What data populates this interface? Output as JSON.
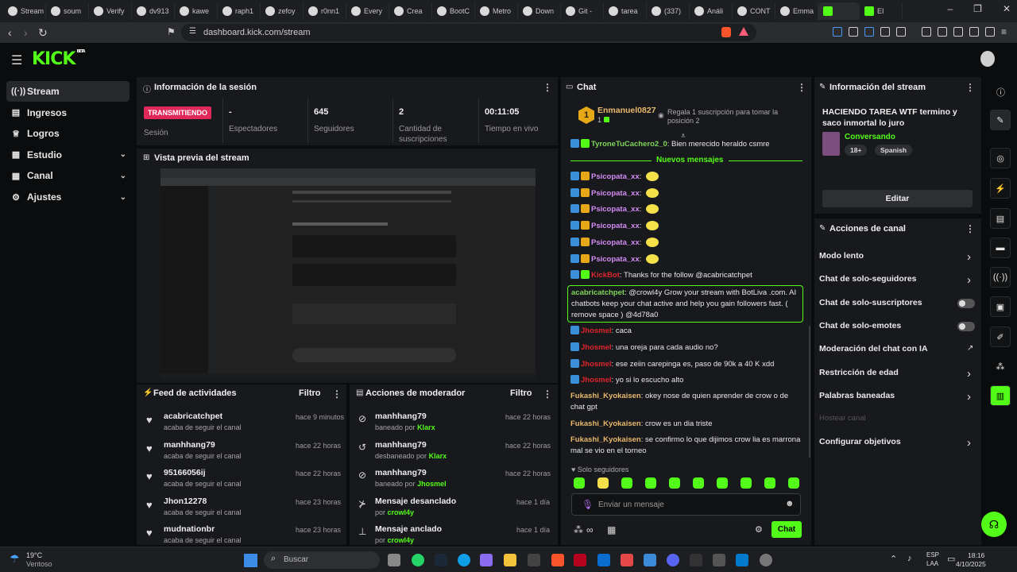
{
  "browser": {
    "tabs": [
      "Stream",
      "soum",
      "Verify",
      "dv913",
      "kawe",
      "raph1",
      "zefoy",
      "r0nn1",
      "Every",
      "Crea",
      "BootC",
      "Metro",
      "Down",
      "Git -",
      "tarea",
      "(337)",
      "Análi",
      "CONT",
      "Emma",
      "",
      "EI"
    ],
    "url": "dashboard.kick.com/stream"
  },
  "brand": {
    "logo": "KICK",
    "beta": "BETA",
    "accent": "#53fc18"
  },
  "sidebar": {
    "items": [
      {
        "label": "Stream",
        "icon": "broadcast-icon",
        "active": true
      },
      {
        "label": "Ingresos",
        "icon": "wallet-icon"
      },
      {
        "label": "Logros",
        "icon": "trophy-icon"
      },
      {
        "label": "Estudio",
        "icon": "layout-icon",
        "expandable": true
      },
      {
        "label": "Canal",
        "icon": "user-icon",
        "expandable": true
      },
      {
        "label": "Ajustes",
        "icon": "gear-icon",
        "expandable": true
      }
    ]
  },
  "session": {
    "title": "Información de la sesión",
    "live_badge": "TRANSMITIENDO",
    "session_label": "Sesión",
    "stats": [
      {
        "value": "-",
        "label": "Espectadores"
      },
      {
        "value": "645",
        "label": "Seguidores"
      },
      {
        "value": "2",
        "label": "Cantidad de suscripciones"
      },
      {
        "value": "00:11:05",
        "label": "Tiempo en vivo"
      }
    ]
  },
  "preview": {
    "title": "Vista previa del stream"
  },
  "activity": {
    "title": "Feed de actividades",
    "filter": "Filtro",
    "items": [
      {
        "name": "acabricatchpet",
        "sub": "acaba de seguir el canal",
        "time": "hace 9 minutos"
      },
      {
        "name": "manhhang79",
        "sub": "acaba de seguir el canal",
        "time": "hace 22 horas"
      },
      {
        "name": "95166056ij",
        "sub": "acaba de seguir el canal",
        "time": "hace 22 horas"
      },
      {
        "name": "Jhon12278",
        "sub": "acaba de seguir el canal",
        "time": "hace 23 horas"
      },
      {
        "name": "mudnationbr",
        "sub": "acaba de seguir el canal",
        "time": "hace 23 horas"
      }
    ]
  },
  "mod": {
    "title": "Acciones de moderador",
    "filter": "Filtro",
    "items": [
      {
        "name": "manhhang79",
        "sub": "baneado por",
        "by": "Klarx",
        "time": "hace 22 horas",
        "icon": "ban-icon"
      },
      {
        "name": "manhhang79",
        "sub": "desbaneado por",
        "by": "Klarx",
        "time": "hace 22 horas",
        "icon": "undo-icon"
      },
      {
        "name": "manhhang79",
        "sub": "baneado por",
        "by": "Jhosmel",
        "time": "hace 22 horas",
        "icon": "ban-icon"
      },
      {
        "name": "Mensaje desanclado",
        "sub": "por",
        "by": "crowl4y",
        "time": "hace 1 día",
        "icon": "unpin-icon"
      },
      {
        "name": "Mensaje anclado",
        "sub": "por",
        "by": "crowl4y",
        "time": "hace 1 día",
        "icon": "pin-icon"
      }
    ]
  },
  "chat": {
    "title": "Chat",
    "top_user": "Enmanuel0827",
    "top_count": "1",
    "rank": "1",
    "gift_msg": "Regala 1 suscripción para tomar la posición 2",
    "prev_msg": {
      "user": "TyroneTuCachero2_0",
      "text": "Bien merecido heraldo csmre"
    },
    "new_messages": "Nuevos mensajes",
    "messages": [
      {
        "user": "Psicopata_xx",
        "text": "",
        "color": "#d38cf5",
        "emoji": true
      },
      {
        "user": "Psicopata_xx",
        "text": "",
        "color": "#d38cf5",
        "emoji": true
      },
      {
        "user": "Psicopata_xx",
        "text": "",
        "color": "#d38cf5",
        "emoji": true
      },
      {
        "user": "Psicopata_xx",
        "text": "",
        "color": "#d38cf5",
        "emoji": true
      },
      {
        "user": "Psicopata_xx",
        "text": "",
        "color": "#d38cf5",
        "emoji": true
      },
      {
        "user": "Psicopata_xx",
        "text": "",
        "color": "#d38cf5",
        "emoji": true
      },
      {
        "user": "KickBot",
        "text": "Thanks for the follow @acabricatchpet",
        "color": "#e0252d"
      }
    ],
    "highlight": {
      "user": "acabricatchpet",
      "text": "@crowl4y Grow your stream with BotLiva .com. AI chatbots keep your chat active and help you gain followers fast. ( remove space ) @4d78a0"
    },
    "messages2": [
      {
        "user": "Jhosmel",
        "text": "caca",
        "color": "#e0252d"
      },
      {
        "user": "Jhosmel",
        "text": "una oreja para cada audio no?",
        "color": "#e0252d"
      },
      {
        "user": "Jhosmel",
        "text": "ese zeiin carepinga es, paso de 90k a 40 K xdd",
        "color": "#e0252d"
      },
      {
        "user": "Jhosmel",
        "text": "yo si lo escucho alto",
        "color": "#e0252d"
      },
      {
        "user": "Fukashi_Kyokaisen",
        "text": "okey nose de quien aprender de crow o de chat gpt",
        "color": "#e8b86d"
      },
      {
        "user": "Fukashi_Kyokaisen",
        "text": "crow es un dia triste",
        "color": "#e8b86d"
      },
      {
        "user": "Fukashi_Kyokaisen",
        "text": "se confirmo lo que dijimos crow lia es marrona mal se vio en el torneo",
        "color": "#e8b86d"
      }
    ],
    "followers_only": "Solo seguidores",
    "input_placeholder": "Enviar un mensaje",
    "send_label": "Chat"
  },
  "stream_info": {
    "title": "Información del stream",
    "stream_title": "HACIENDO TAREA WTF termino y saco inmortal lo juro",
    "category": "Conversando",
    "tags": [
      "18+",
      "Spanish"
    ],
    "edit": "Editar"
  },
  "channel_actions": {
    "title": "Acciones de canal",
    "items": [
      {
        "label": "Modo lento",
        "control": "chevron"
      },
      {
        "label": "Chat de solo-seguidores",
        "control": "chevron"
      },
      {
        "label": "Chat de solo-suscriptores",
        "control": "toggle"
      },
      {
        "label": "Chat de solo-emotes",
        "control": "toggle"
      },
      {
        "label": "Moderación del chat con IA",
        "control": "external"
      },
      {
        "label": "Restricción de edad",
        "control": "chevron"
      },
      {
        "label": "Palabras baneadas",
        "control": "chevron"
      },
      {
        "label": "Hostear canal",
        "control": "disabled"
      },
      {
        "label": "Configurar objetivos",
        "control": "chevron"
      }
    ]
  },
  "taskbar": {
    "weather_temp": "19°C",
    "weather_desc": "Ventoso",
    "search": "Buscar",
    "lang1": "ESP",
    "lang2": "LAA",
    "time": "18:16",
    "date": "4/10/2025"
  }
}
